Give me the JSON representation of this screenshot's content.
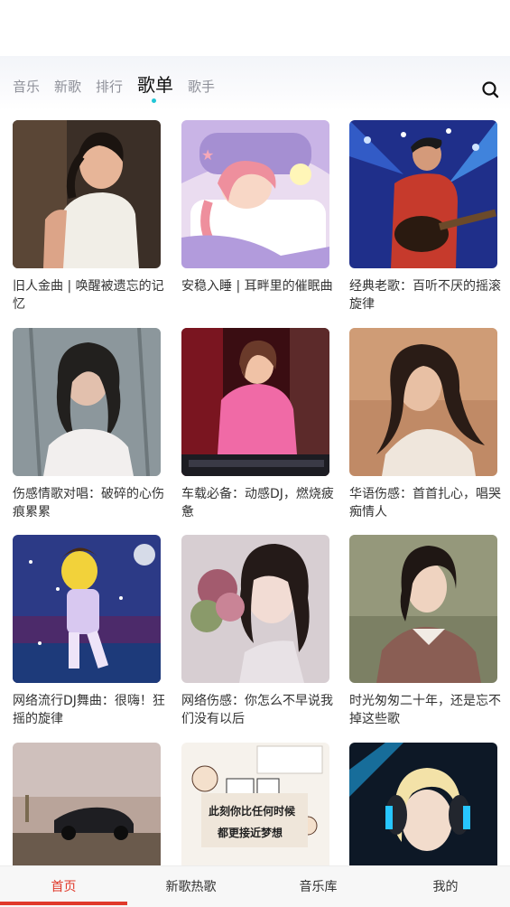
{
  "tabs": [
    {
      "label": "音乐",
      "active": false
    },
    {
      "label": "新歌",
      "active": false
    },
    {
      "label": "排行",
      "active": false
    },
    {
      "label": "歌单",
      "active": true
    },
    {
      "label": "歌手",
      "active": false
    }
  ],
  "search_icon": "search-icon",
  "playlists": [
    {
      "title": "旧人金曲 | 唤醒被遗忘的记忆"
    },
    {
      "title": "安稳入睡 | 耳畔里的催眠曲"
    },
    {
      "title": "经典老歌：百听不厌的摇滚旋律"
    },
    {
      "title": "伤感情歌对唱：破碎的心伤痕累累"
    },
    {
      "title": "车载必备：动感DJ，燃烧疲惫"
    },
    {
      "title": "华语伤感：首首扎心，唱哭痴情人"
    },
    {
      "title": "网络流行DJ舞曲：很嗨！狂摇的旋律"
    },
    {
      "title": "网络伤感：你怎么不早说我们没有以后"
    },
    {
      "title": "时光匆匆二十年，还是忘不掉这些歌"
    },
    {
      "title": ""
    },
    {
      "title": ""
    },
    {
      "title": ""
    }
  ],
  "cover_texts": {
    "sign_line1": "此刻你比任何时候",
    "sign_line2": "都更接近梦想"
  },
  "bottom_nav": [
    {
      "label": "首页",
      "active": true
    },
    {
      "label": "新歌热歌",
      "active": false
    },
    {
      "label": "音乐库",
      "active": false
    },
    {
      "label": "我的",
      "active": false
    }
  ],
  "colors": {
    "accent_red": "#e03a2b",
    "tab_indicator": "#22c6d6",
    "tab_inactive": "#8e9099"
  }
}
